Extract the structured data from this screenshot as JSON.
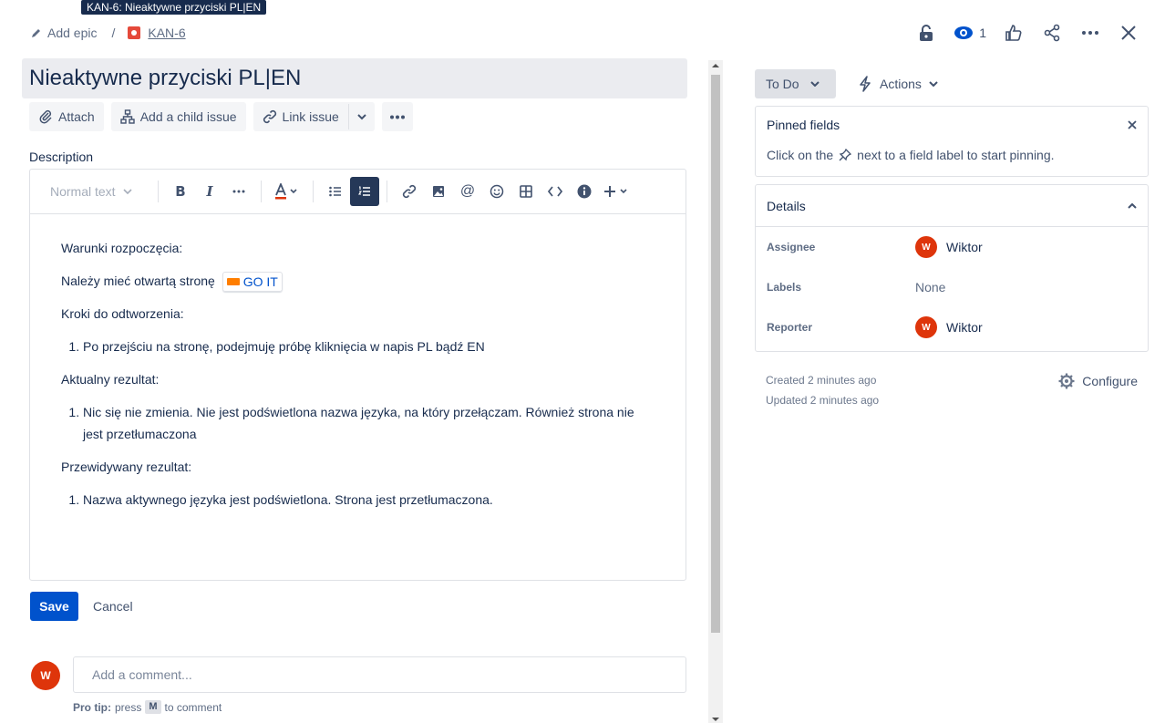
{
  "tooltip": "KAN-6: Nieaktywne przyciski PL|EN",
  "breadcrumb": {
    "add_epic": "Add epic",
    "separator": "/",
    "issue_key": "KAN-6"
  },
  "header": {
    "watch_count": "1"
  },
  "issue": {
    "title": "Nieaktywne przyciski PL|EN"
  },
  "toolbar_buttons": {
    "attach": "Attach",
    "child_issue": "Add a child issue",
    "link_issue": "Link issue"
  },
  "description": {
    "label": "Description",
    "format": "Normal text",
    "p1": "Warunki rozpoczęcia:",
    "p2": "Należy mieć otwartą stronę",
    "chip": "GO IT",
    "p3": "Kroki do odtworzenia:",
    "li1": "Po przejściu na stronę, podejmuję próbę kliknięcia w napis PL bądź EN",
    "p4": "Aktualny rezultat:",
    "li2": "Nic się nie zmienia. Nie jest podświetlona nazwa języka, na który przełączam. Również strona nie jest przetłumaczona",
    "p5": "Przewidywany rezultat:",
    "li3": "Nazwa aktywnego języka jest podświetlona. Strona jest przetłumaczona."
  },
  "editor_actions": {
    "save": "Save",
    "cancel": "Cancel"
  },
  "comment": {
    "avatar": "W",
    "placeholder": "Add a comment...",
    "protip_label": "Pro tip:",
    "protip_press": "press",
    "protip_key": "M",
    "protip_rest": "to comment"
  },
  "sidebar": {
    "status": "To Do",
    "actions": "Actions",
    "pinned_title": "Pinned fields",
    "pinned_text_before": "Click on the",
    "pinned_text_after": "next to a field label to start pinning.",
    "details_title": "Details",
    "assignee_label": "Assignee",
    "assignee": "Wiktor",
    "assignee_initial": "W",
    "labels_label": "Labels",
    "labels_value": "None",
    "reporter_label": "Reporter",
    "reporter": "Wiktor",
    "reporter_initial": "W",
    "created": "Created 2 minutes ago",
    "updated": "Updated 2 minutes ago",
    "configure": "Configure"
  },
  "colors": {
    "primary": "#0052cc",
    "avatar": "#de350b",
    "issue_icon": "#e5493a"
  }
}
